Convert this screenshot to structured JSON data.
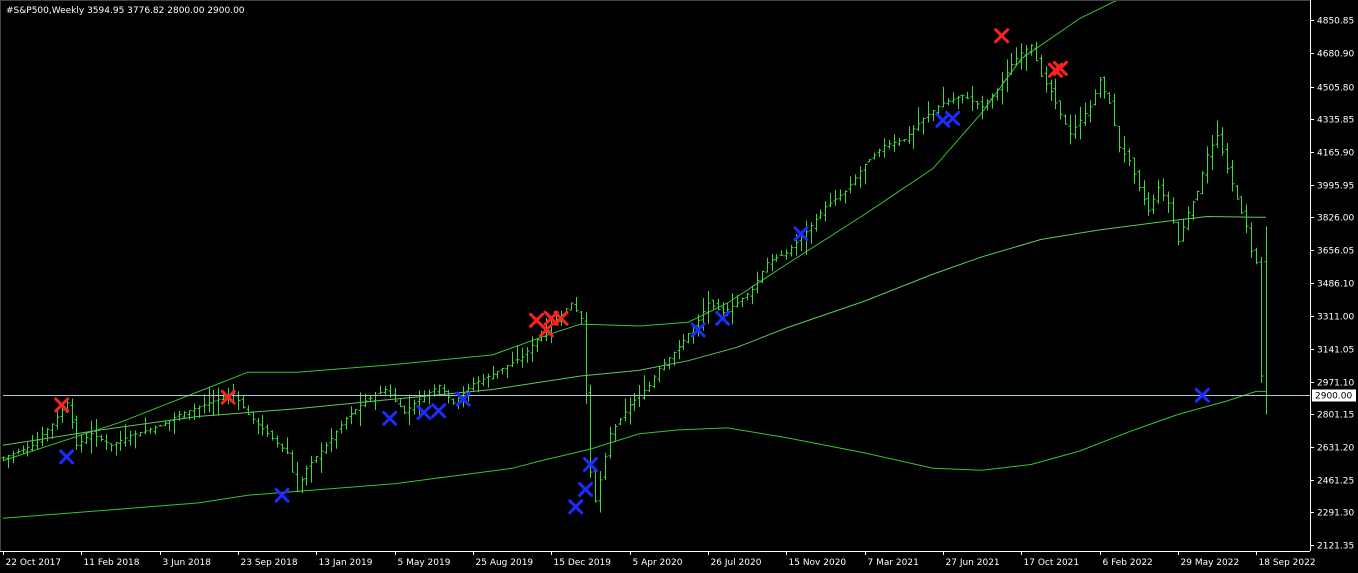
{
  "chart_data": {
    "type": "ohlc",
    "title": "#S&P500,Weekly  3594.95 3776.82 2800.00 2900.00",
    "colors": {
      "background": "#000000",
      "axis": "#ffffff",
      "bars": "#3fd63f",
      "bands": "#35c435",
      "ma": "#5fc95f",
      "hline": "#a6c7dc",
      "up_signal": "#1c2cff",
      "down_signal": "#ff2020",
      "price_label_bg": "#ffffff",
      "price_label_text": "#000000"
    },
    "current_price": {
      "value": 2900.0,
      "label": "2900.00"
    },
    "y_axis": {
      "range": [
        2090,
        4935
      ],
      "ticks": [
        {
          "value": 4850.85,
          "label": "4850.85"
        },
        {
          "value": 4680.9,
          "label": "4680.90"
        },
        {
          "value": 4505.8,
          "label": "4505.80"
        },
        {
          "value": 4335.85,
          "label": "4335.85"
        },
        {
          "value": 4165.9,
          "label": "4165.90"
        },
        {
          "value": 3995.95,
          "label": "3995.95"
        },
        {
          "value": 3826.0,
          "label": "3826.00"
        },
        {
          "value": 3656.05,
          "label": "3656.05"
        },
        {
          "value": 3486.1,
          "label": "3486.10"
        },
        {
          "value": 3311.0,
          "label": "3311.00"
        },
        {
          "value": 3141.05,
          "label": "3141.05"
        },
        {
          "value": 2971.1,
          "label": "2971.10"
        },
        {
          "value": 2801.15,
          "label": "2801.15"
        },
        {
          "value": 2631.2,
          "label": "2631.20"
        },
        {
          "value": 2461.25,
          "label": "2461.25"
        },
        {
          "value": 2291.3,
          "label": "2291.30"
        },
        {
          "value": 2121.35,
          "label": "2121.35"
        }
      ]
    },
    "x_axis": {
      "week_range": [
        0,
        267
      ],
      "ticks": [
        {
          "week": 0,
          "label": "22 Oct 2017"
        },
        {
          "week": 16,
          "label": "11 Feb 2018"
        },
        {
          "week": 32,
          "label": "3 Jun 2018"
        },
        {
          "week": 48,
          "label": "23 Sep 2018"
        },
        {
          "week": 64,
          "label": "13 Jan 2019"
        },
        {
          "week": 80,
          "label": "5 May 2019"
        },
        {
          "week": 96,
          "label": "25 Aug 2019"
        },
        {
          "week": 112,
          "label": "15 Dec 2019"
        },
        {
          "week": 128,
          "label": "5 Apr 2020"
        },
        {
          "week": 144,
          "label": "26 Jul 2020"
        },
        {
          "week": 160,
          "label": "15 Nov 2020"
        },
        {
          "week": 176,
          "label": "7 Mar 2021"
        },
        {
          "week": 192,
          "label": "27 Jun 2021"
        },
        {
          "week": 208,
          "label": "17 Oct 2021"
        },
        {
          "week": 224,
          "label": "6 Feb 2022"
        },
        {
          "week": 240,
          "label": "29 May 2022"
        },
        {
          "week": 256,
          "label": "18 Sep 2022"
        }
      ]
    },
    "price_path": [
      [
        0,
        2575
      ],
      [
        6,
        2640
      ],
      [
        10,
        2750
      ],
      [
        13,
        2860
      ],
      [
        14,
        2760
      ],
      [
        15,
        2640
      ],
      [
        18,
        2700
      ],
      [
        22,
        2640
      ],
      [
        26,
        2690
      ],
      [
        32,
        2740
      ],
      [
        36,
        2800
      ],
      [
        42,
        2860
      ],
      [
        47,
        2910
      ],
      [
        50,
        2800
      ],
      [
        54,
        2700
      ],
      [
        58,
        2600
      ],
      [
        60,
        2400
      ],
      [
        62,
        2520
      ],
      [
        66,
        2640
      ],
      [
        70,
        2780
      ],
      [
        74,
        2870
      ],
      [
        78,
        2930
      ],
      [
        82,
        2810
      ],
      [
        85,
        2880
      ],
      [
        89,
        2950
      ],
      [
        92,
        2860
      ],
      [
        96,
        2960
      ],
      [
        100,
        3010
      ],
      [
        106,
        3100
      ],
      [
        110,
        3220
      ],
      [
        114,
        3320
      ],
      [
        116,
        3380
      ],
      [
        118,
        3300
      ],
      [
        119,
        2900
      ],
      [
        120,
        2500
      ],
      [
        121,
        2350
      ],
      [
        122,
        2460
      ],
      [
        124,
        2700
      ],
      [
        128,
        2850
      ],
      [
        132,
        2950
      ],
      [
        134,
        3040
      ],
      [
        138,
        3150
      ],
      [
        142,
        3290
      ],
      [
        144,
        3380
      ],
      [
        147,
        3330
      ],
      [
        150,
        3380
      ],
      [
        153,
        3450
      ],
      [
        156,
        3590
      ],
      [
        160,
        3640
      ],
      [
        164,
        3750
      ],
      [
        168,
        3880
      ],
      [
        172,
        3960
      ],
      [
        176,
        4100
      ],
      [
        180,
        4200
      ],
      [
        184,
        4230
      ],
      [
        188,
        4340
      ],
      [
        192,
        4420
      ],
      [
        196,
        4460
      ],
      [
        200,
        4400
      ],
      [
        203,
        4490
      ],
      [
        206,
        4620
      ],
      [
        208,
        4680
      ],
      [
        210,
        4720
      ],
      [
        212,
        4560
      ],
      [
        214,
        4480
      ],
      [
        216,
        4360
      ],
      [
        218,
        4260
      ],
      [
        220,
        4330
      ],
      [
        222,
        4400
      ],
      [
        224,
        4540
      ],
      [
        226,
        4420
      ],
      [
        228,
        4190
      ],
      [
        230,
        4120
      ],
      [
        232,
        3980
      ],
      [
        234,
        3860
      ],
      [
        236,
        3980
      ],
      [
        238,
        3900
      ],
      [
        240,
        3700
      ],
      [
        242,
        3850
      ],
      [
        244,
        3960
      ],
      [
        246,
        4150
      ],
      [
        248,
        4250
      ],
      [
        250,
        4080
      ],
      [
        252,
        3920
      ],
      [
        254,
        3780
      ],
      [
        255,
        3650
      ],
      [
        256,
        3590
      ],
      [
        257,
        3000
      ],
      [
        258,
        2870
      ]
    ],
    "price_high": 3776.82,
    "price_low": 2800.0,
    "upper_band": [
      [
        0,
        2560
      ],
      [
        24,
        2760
      ],
      [
        42,
        2940
      ],
      [
        50,
        3020
      ],
      [
        60,
        3020
      ],
      [
        80,
        3060
      ],
      [
        100,
        3110
      ],
      [
        112,
        3220
      ],
      [
        118,
        3270
      ],
      [
        130,
        3260
      ],
      [
        140,
        3280
      ],
      [
        148,
        3380
      ],
      [
        160,
        3580
      ],
      [
        176,
        3840
      ],
      [
        190,
        4080
      ],
      [
        200,
        4370
      ],
      [
        208,
        4650
      ],
      [
        220,
        4860
      ],
      [
        228,
        4960
      ]
    ],
    "lower_band": [
      [
        0,
        2260
      ],
      [
        20,
        2300
      ],
      [
        40,
        2340
      ],
      [
        50,
        2380
      ],
      [
        60,
        2400
      ],
      [
        80,
        2440
      ],
      [
        92,
        2480
      ],
      [
        104,
        2520
      ],
      [
        110,
        2560
      ],
      [
        120,
        2620
      ],
      [
        130,
        2700
      ],
      [
        138,
        2720
      ],
      [
        148,
        2730
      ],
      [
        160,
        2680
      ],
      [
        176,
        2600
      ],
      [
        190,
        2520
      ],
      [
        200,
        2510
      ],
      [
        210,
        2540
      ],
      [
        220,
        2610
      ],
      [
        230,
        2710
      ],
      [
        240,
        2800
      ],
      [
        250,
        2870
      ],
      [
        256,
        2920
      ],
      [
        258,
        2920
      ]
    ],
    "moving_average": [
      [
        0,
        2640
      ],
      [
        20,
        2720
      ],
      [
        40,
        2790
      ],
      [
        60,
        2830
      ],
      [
        80,
        2880
      ],
      [
        100,
        2930
      ],
      [
        118,
        3000
      ],
      [
        130,
        3030
      ],
      [
        140,
        3080
      ],
      [
        150,
        3150
      ],
      [
        160,
        3250
      ],
      [
        176,
        3390
      ],
      [
        190,
        3530
      ],
      [
        200,
        3620
      ],
      [
        212,
        3710
      ],
      [
        224,
        3760
      ],
      [
        236,
        3800
      ],
      [
        246,
        3830
      ],
      [
        256,
        3826
      ],
      [
        258,
        3826
      ]
    ],
    "signals": [
      {
        "week": 12,
        "value": 2850,
        "type": "down"
      },
      {
        "week": 13,
        "value": 2580,
        "type": "up"
      },
      {
        "week": 46,
        "value": 2890,
        "type": "down"
      },
      {
        "week": 57,
        "value": 2380,
        "type": "up"
      },
      {
        "week": 79,
        "value": 2780,
        "type": "up"
      },
      {
        "week": 86,
        "value": 2810,
        "type": "up"
      },
      {
        "week": 89,
        "value": 2820,
        "type": "up"
      },
      {
        "week": 94,
        "value": 2880,
        "type": "up"
      },
      {
        "week": 109,
        "value": 3290,
        "type": "down"
      },
      {
        "week": 111,
        "value": 3240,
        "type": "down"
      },
      {
        "week": 112,
        "value": 3300,
        "type": "down"
      },
      {
        "week": 114,
        "value": 3300,
        "type": "down"
      },
      {
        "week": 117,
        "value": 2320,
        "type": "up"
      },
      {
        "week": 119,
        "value": 2410,
        "type": "up"
      },
      {
        "week": 120,
        "value": 2540,
        "type": "up"
      },
      {
        "week": 142,
        "value": 3240,
        "type": "up"
      },
      {
        "week": 147,
        "value": 3300,
        "type": "up"
      },
      {
        "week": 163,
        "value": 3740,
        "type": "up"
      },
      {
        "week": 192,
        "value": 4330,
        "type": "up"
      },
      {
        "week": 194,
        "value": 4340,
        "type": "up"
      },
      {
        "week": 204,
        "value": 4770,
        "type": "down"
      },
      {
        "week": 215,
        "value": 4590,
        "type": "down"
      },
      {
        "week": 216,
        "value": 4600,
        "type": "down"
      },
      {
        "week": 245,
        "value": 2900,
        "type": "up"
      }
    ]
  }
}
